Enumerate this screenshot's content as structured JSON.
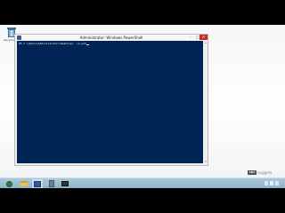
{
  "desktop": {
    "recycle_bin_label": "Recycle Bin"
  },
  "window": {
    "title": "Administrator: Windows PowerShell",
    "minimize_glyph": "–",
    "maximize_glyph": "□",
    "close_glyph": "✕",
    "console_line": "PS C:\\Users\\Administrator\\Desktop> .\\s.ps1"
  },
  "watermark": {
    "badge": "CBT",
    "text": "nuggets"
  },
  "taskbar": {
    "items": [
      {
        "name": "start",
        "icon": "windows-start-icon"
      },
      {
        "name": "file-explorer",
        "icon": "folder-icon"
      },
      {
        "name": "powershell",
        "icon": "powershell-icon",
        "active": true
      },
      {
        "name": "server-manager",
        "icon": "server-manager-icon"
      },
      {
        "name": "command-prompt",
        "icon": "cmd-icon"
      }
    ],
    "tray_icons": [
      "flag-icon",
      "network-icon",
      "volume-icon"
    ]
  },
  "colors": {
    "console_bg": "#012456",
    "console_fg": "#eeedf0",
    "close_button": "#c9302c",
    "taskbar": "#9fbfd1"
  }
}
